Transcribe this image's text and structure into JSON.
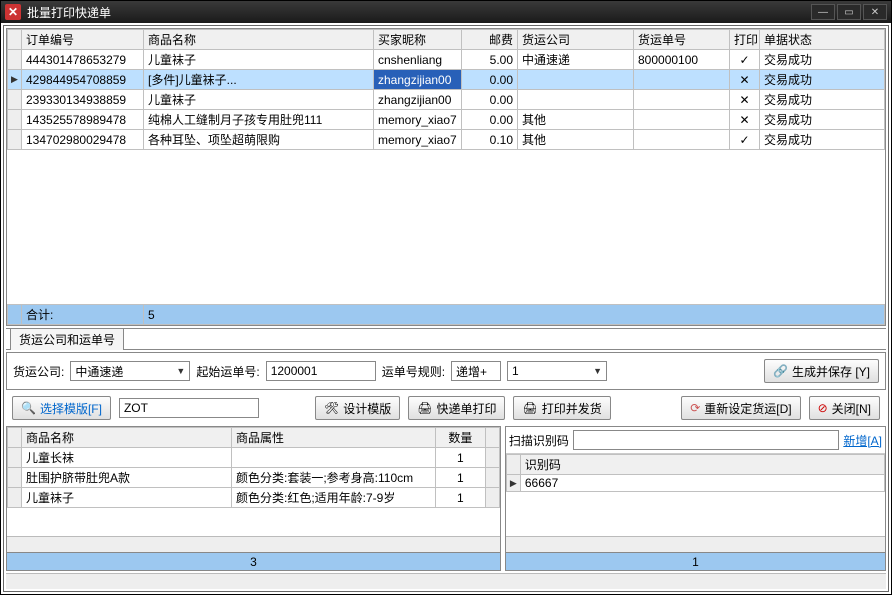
{
  "window": {
    "title": "批量打印快递单"
  },
  "winbtns": {
    "min": "—",
    "max": "▭",
    "close": "✕"
  },
  "grid1": {
    "headers": [
      "订单编号",
      "商品名称",
      "买家昵称",
      "邮费",
      "货运公司",
      "货运单号",
      "打印",
      "单据状态"
    ],
    "rows": [
      {
        "mark": "",
        "id": "444301478653279",
        "name": "儿童袜子",
        "buyer": "cnshenliang",
        "fee": "5.00",
        "ship": "中通速递",
        "wayno": "800000100",
        "print": "✓",
        "status": "交易成功",
        "sel": false
      },
      {
        "mark": "▶",
        "id": "429844954708859",
        "name": "[多件]儿童袜子...",
        "buyer": "zhangzijian00",
        "fee": "0.00",
        "ship": "",
        "wayno": "",
        "print": "✕",
        "status": "交易成功",
        "sel": true
      },
      {
        "mark": "",
        "id": "239330134938859",
        "name": "儿童袜子",
        "buyer": "zhangzijian00",
        "fee": "0.00",
        "ship": "",
        "wayno": "",
        "print": "✕",
        "status": "交易成功",
        "sel": false
      },
      {
        "mark": "",
        "id": "143525578989478",
        "name": "纯棉人工缝制月子孩专用肚兜111",
        "buyer": "memory_xiao7",
        "fee": "0.00",
        "ship": "其他",
        "wayno": "",
        "print": "✕",
        "status": "交易成功",
        "sel": false
      },
      {
        "mark": "",
        "id": "134702980029478",
        "name": "各种耳坠、项坠超萌限购",
        "buyer": "memory_xiao7",
        "fee": "0.10",
        "ship": "其他",
        "wayno": "",
        "print": "✓",
        "status": "交易成功",
        "sel": false
      }
    ],
    "total_label": "合计:",
    "total_count": "5"
  },
  "tabs": {
    "t1": "货运公司和运单号"
  },
  "form": {
    "ship_label": "货运公司:",
    "ship_value": "中通速递",
    "start_label": "起始运单号:",
    "start_value": "1200001",
    "rule_label": "运单号规则:",
    "rule_a": "递增+",
    "rule_b": "1",
    "gen_btn": "生成并保存 [Y]"
  },
  "btnrow": {
    "choose_tpl": "选择模版[F]",
    "tpl_code": "ZOT",
    "design": "设计模版",
    "print_express": "快递单打印",
    "print_ship": "打印并发货",
    "reset_ship": "重新设定货运[D]",
    "close": "关闭[N]"
  },
  "grid2": {
    "headers": [
      "商品名称",
      "商品属性",
      "数量"
    ],
    "rows": [
      {
        "name": "儿童长袜",
        "attr": "",
        "qty": "1"
      },
      {
        "name": "肚围护脐带肚兜A款",
        "attr": "颜色分类:套装一;参考身高:110cm",
        "qty": "1"
      },
      {
        "name": "儿童袜子",
        "attr": "颜色分类:红色;适用年龄:7-9岁",
        "qty": "1"
      }
    ],
    "total": "3"
  },
  "grid3": {
    "scan_label": "扫描识别码",
    "add": "新增[A]",
    "header": "识别码",
    "rows": [
      {
        "mark": "▶",
        "code": "66667"
      }
    ],
    "total": "1"
  }
}
